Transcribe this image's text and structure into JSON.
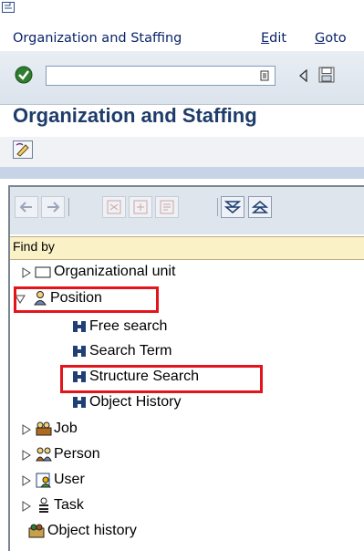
{
  "menubar": {
    "icon": "sap-menu-icon",
    "items": [
      {
        "label": "Organization and Staffing"
      },
      {
        "label": "Edit",
        "mnemonic": "E",
        "rest": "dit"
      },
      {
        "label": "Goto",
        "mnemonic": "G",
        "rest": "oto"
      }
    ]
  },
  "toolbar": {
    "command_field_value": "",
    "icons": [
      "enter-checkmark-icon",
      "dropdown-icon",
      "back-arrow-icon",
      "save-icon"
    ]
  },
  "page": {
    "title": "Organization and Staffing"
  },
  "nav": {
    "toolbar_icons": [
      "previous-icon",
      "next-icon",
      "icon-disabled-1",
      "icon-disabled-2",
      "icon-disabled-3",
      "expand-all-icon",
      "collapse-all-icon"
    ],
    "findby_label": "Find by",
    "tree": [
      {
        "label": "Organizational unit",
        "icon": "org-unit-icon",
        "expanded": false
      },
      {
        "label": "Position",
        "icon": "position-icon",
        "expanded": true,
        "highlighted": true,
        "children": [
          {
            "label": "Free search",
            "icon": "binoculars-icon"
          },
          {
            "label": "Search Term",
            "icon": "binoculars-icon"
          },
          {
            "label": "Structure Search",
            "icon": "binoculars-icon",
            "highlighted": true
          },
          {
            "label": "Object History",
            "icon": "binoculars-icon"
          }
        ]
      },
      {
        "label": "Job",
        "icon": "job-icon",
        "expanded": false
      },
      {
        "label": "Person",
        "icon": "person-icon",
        "expanded": false
      },
      {
        "label": "User",
        "icon": "user-icon",
        "expanded": false
      },
      {
        "label": "Task",
        "icon": "task-icon",
        "expanded": false
      },
      {
        "label": "Object history",
        "icon": "object-history-icon"
      }
    ]
  },
  "colors": {
    "highlight": "#e3141c",
    "title": "#1e3c6a",
    "findby_bg": "#fbf1c7"
  }
}
